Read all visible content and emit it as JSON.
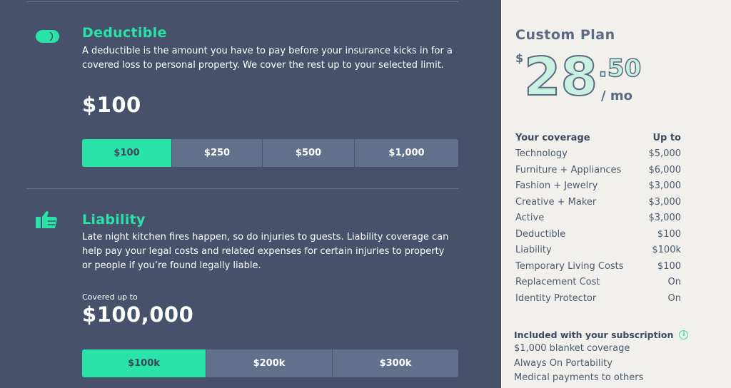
{
  "deductible": {
    "title": "Deductible",
    "description": "A deductible is the amount you have to pay before your insurance kicks in for a covered loss to personal property. We cover the rest up to your selected limit.",
    "amount": "$100",
    "options": [
      "$100",
      "$250",
      "$500",
      "$1,000"
    ],
    "selected": "$100"
  },
  "liability": {
    "title": "Liability",
    "description": "Late night kitchen fires happen, so do injuries to guests. Liability coverage can help pay your legal costs and related expenses for certain injuries to property or people if you’re found legally liable.",
    "covered_label": "Covered up to",
    "amount": "$100,000",
    "options": [
      "$100k",
      "$200k",
      "$300k"
    ],
    "selected": "$100k"
  },
  "plan": {
    "title": "Custom Plan",
    "currency": "$",
    "dollars": "28",
    "cents": ".50",
    "period": "/ mo",
    "coverage_header": "Your coverage",
    "upto_header": "Up to",
    "coverage": [
      {
        "name": "Technology",
        "value": "$5,000"
      },
      {
        "name": "Furniture + Appliances",
        "value": "$6,000"
      },
      {
        "name": "Fashion + Jewelry",
        "value": "$3,000"
      },
      {
        "name": "Creative + Maker",
        "value": "$3,000"
      },
      {
        "name": "Active",
        "value": "$3,000"
      },
      {
        "name": "Deductible",
        "value": "$100"
      },
      {
        "name": "Liability",
        "value": "$100k"
      },
      {
        "name": "Temporary Living Costs",
        "value": "$100"
      },
      {
        "name": "Replacement Cost",
        "value": "On"
      },
      {
        "name": "Identity Protector",
        "value": "On"
      }
    ],
    "included_header": "Included with your subscription",
    "included": [
      "$1,000 blanket coverage",
      "Always On Portability",
      "Medical payments to others"
    ]
  },
  "colors": {
    "accent": "#2ae3a8",
    "background": "#47526a",
    "sidebar": "#f1f0ed",
    "button": "#61708b"
  }
}
